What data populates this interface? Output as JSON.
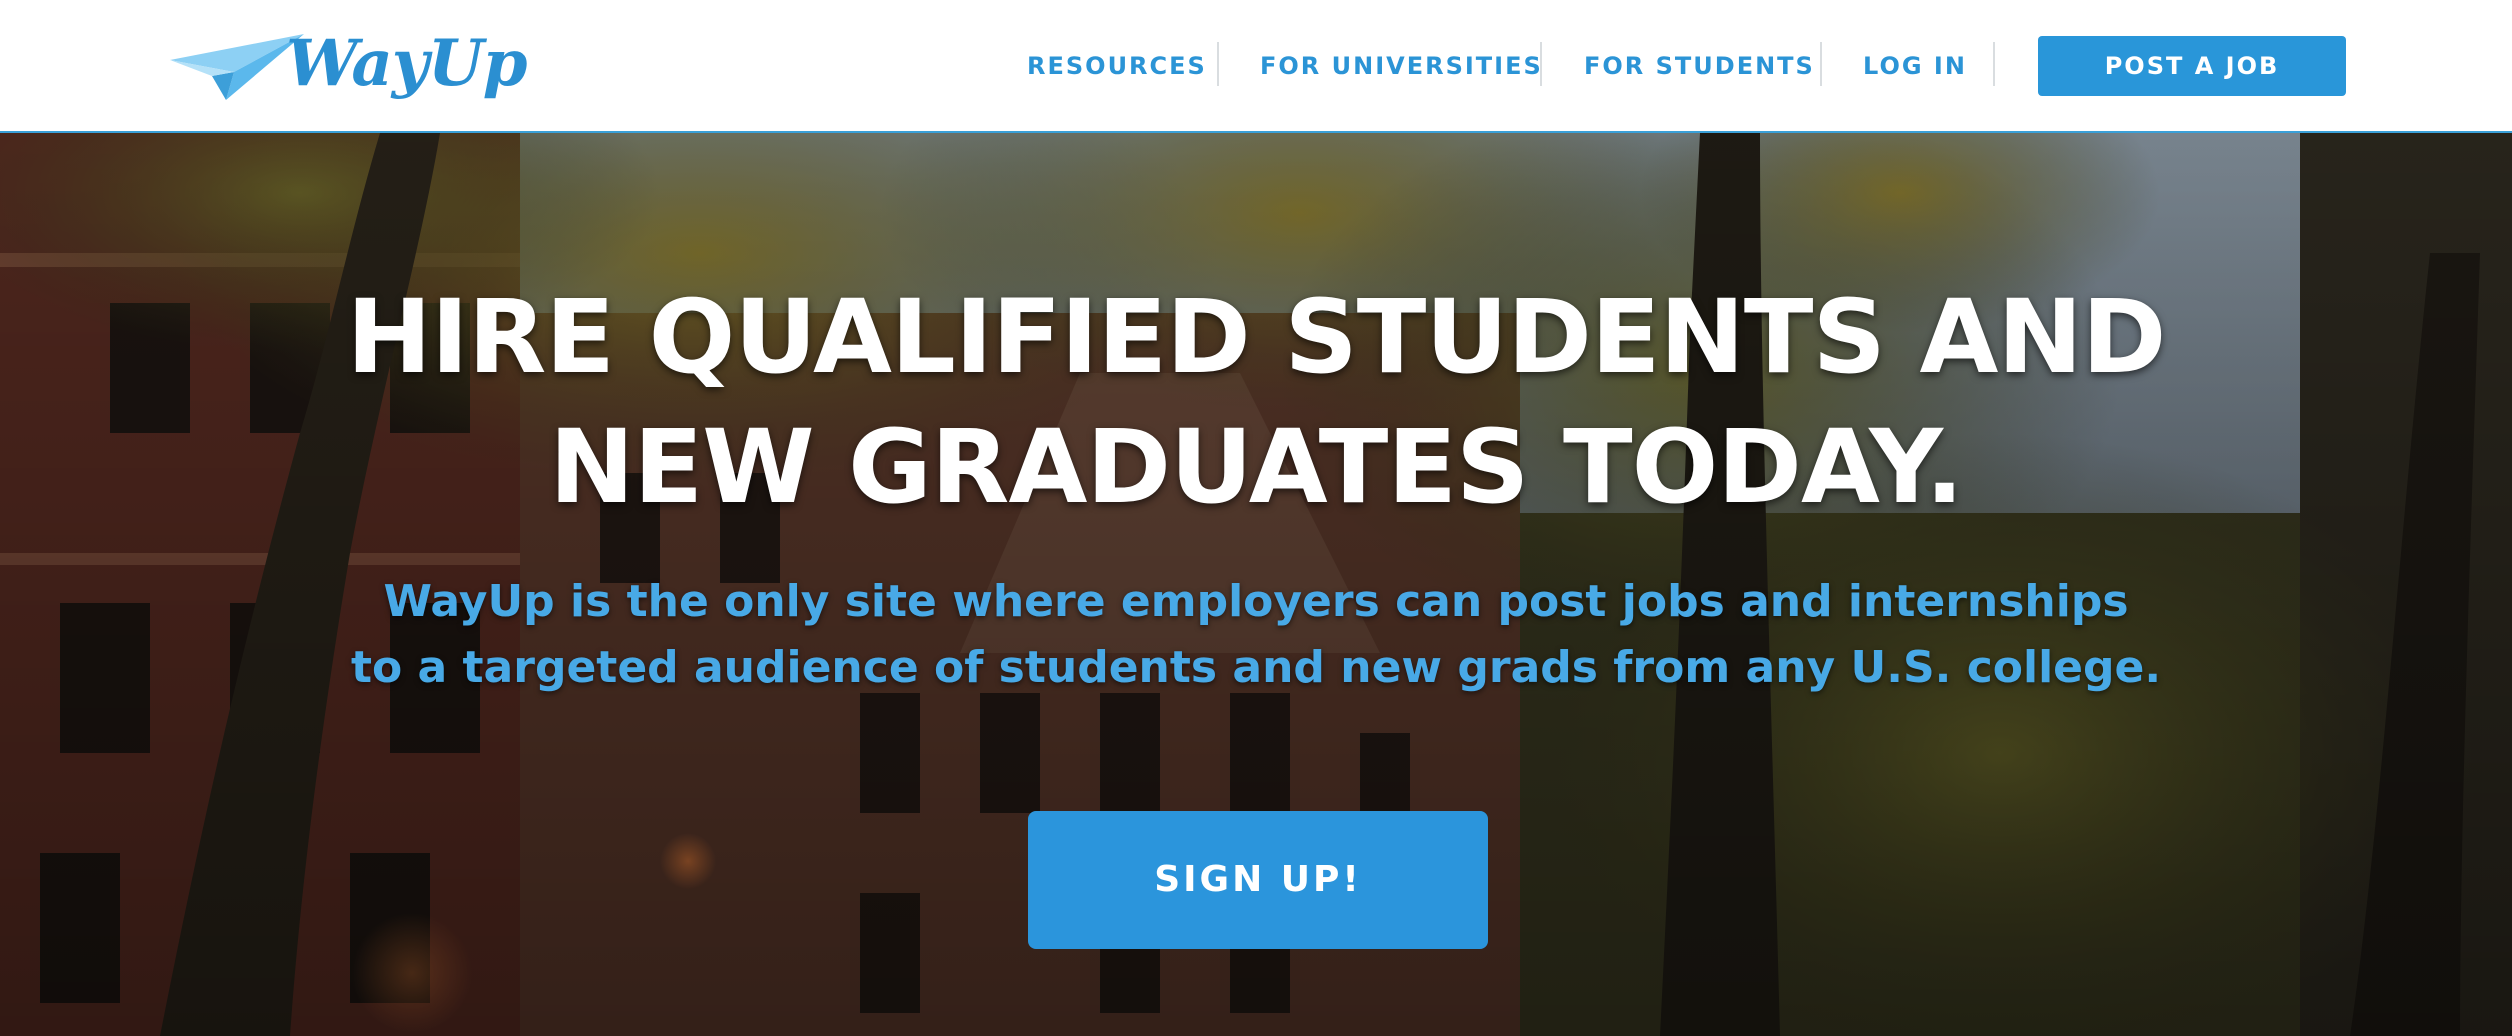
{
  "header": {
    "logo_text": "WayUp",
    "nav": {
      "resources": "RESOURCES",
      "universities": "FOR UNIVERSITIES",
      "students": "FOR STUDENTS",
      "login": "LOG IN"
    },
    "post_job": "POST A JOB"
  },
  "hero": {
    "title_line1": "HIRE QUALIFIED STUDENTS AND",
    "title_line2": "NEW GRADUATES TODAY.",
    "sub_line1": "WayUp is the only site where employers can post jobs and internships",
    "sub_line2": "to a targeted audience of students and new grads from any U.S. college.",
    "cta": "SIGN UP!"
  },
  "colors": {
    "brand": "#2b94d6",
    "button": "#2996d9",
    "subtitle": "#48a9e6",
    "hero_title": "#ffffff"
  },
  "icons": [
    "paper-plane-icon"
  ]
}
